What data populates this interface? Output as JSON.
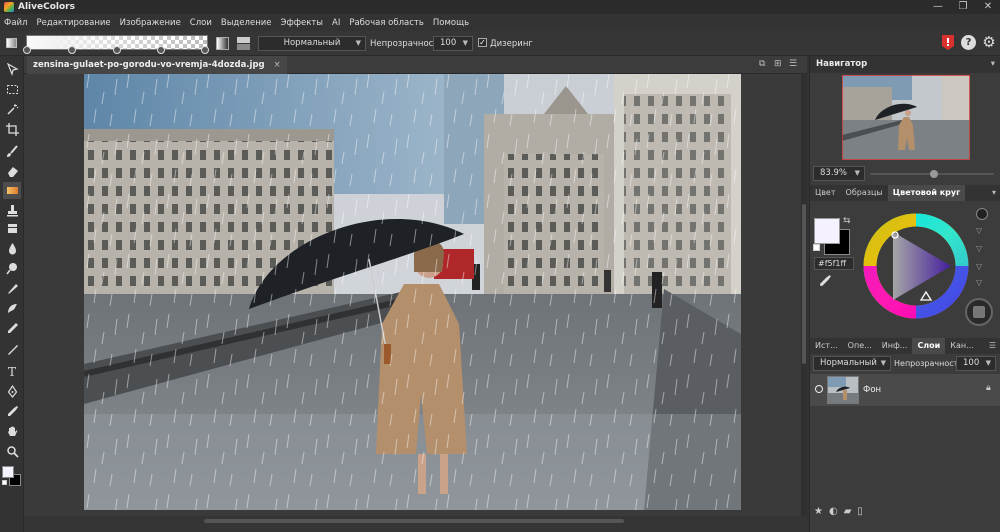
{
  "app": {
    "title": "AliveColors"
  },
  "menu": [
    "Файл",
    "Редактирование",
    "Изображение",
    "Слои",
    "Выделение",
    "Эффекты",
    "AI",
    "Рабочая область",
    "Помощь"
  ],
  "options": {
    "blend_mode": "Нормальный",
    "opacity_label": "Непрозрачность",
    "opacity_value": "100",
    "dithering_label": "Дизеринг",
    "dithering_checked": true
  },
  "document": {
    "tab_label": "zensina-gulaet-po-gorodu-vo-vremja-4dozda.jpg",
    "close": "×"
  },
  "navigator": {
    "title": "Навигатор",
    "zoom": "83.9%"
  },
  "color_panel": {
    "tabs": [
      "Цвет",
      "Образцы",
      "Цветовой круг"
    ],
    "active_tab": "Цветовой круг",
    "hex": "#f5f1ff",
    "foreground": "#f5f1ff",
    "background": "#000000"
  },
  "layers_panel": {
    "tabs": [
      "Ист...",
      "Опе...",
      "Инф...",
      "Слои",
      "Кан..."
    ],
    "active_tab": "Слои",
    "blend_mode": "Нормальный",
    "opacity_label": "Непрозрачность",
    "opacity_value": "100",
    "layers": [
      {
        "name": "Фон",
        "visible": true,
        "locked": true
      }
    ]
  },
  "colors": {
    "accent_red": "#d9322e",
    "wheel_triangle": "#6a2ff0"
  }
}
